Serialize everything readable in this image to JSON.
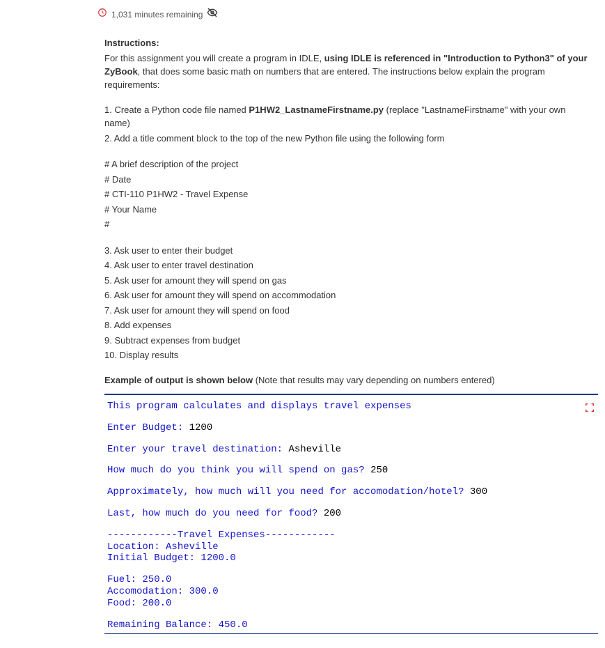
{
  "header": {
    "minutes_remaining": "1,031 minutes remaining"
  },
  "instructions": {
    "label": "Instructions:",
    "intro_pre": "For this assignment you will create a program in IDLE, ",
    "intro_bold": "using IDLE is referenced in \"Introduction to Python3\" of your ZyBook",
    "intro_post": ", that does some basic math on numbers that are entered. The instructions below explain the program requirements:",
    "step1_pre": "1. Create a Python code file named ",
    "step1_bold": "P1HW2_LastnameFirstname.py",
    "step1_post": " (replace \"LastnameFirstname\" with your own name)",
    "step2": "2. Add a title comment block to the top of the new Python file using the following form",
    "comment_lines": [
      "# A brief description of the project",
      "# Date",
      "# CTI-110 P1HW2 - Travel Expense",
      "# Your Name",
      "#"
    ],
    "steps_rest": [
      "3. Ask user to enter their budget",
      "4. Ask user to enter travel destination",
      "5. Ask user for amount they will spend on gas",
      "6. Ask user for amount they will spend on accommodation",
      "7. Ask user for amount they will spend on food",
      "8. Add expenses",
      "9. Subtract expenses from budget",
      "10. Display results"
    ],
    "example_bold": "Example of output is shown below",
    "example_rest": " (Note that results may vary depending on numbers entered)"
  },
  "code": {
    "l1": "This program calculates and displays travel expenses",
    "l2p": "Enter Budget: ",
    "l2v": "1200",
    "l3p": "Enter your travel destination: ",
    "l3v": "Asheville",
    "l4p": "How much do you think you will spend on gas? ",
    "l4v": "250",
    "l5p": "Approximately, how much will you need for accomodation/hotel? ",
    "l5v": "300",
    "l6p": "Last, how much do you need for food? ",
    "l6v": "200",
    "l7": "------------Travel Expenses------------",
    "l8": "Location: Asheville",
    "l9": "Initial Budget: 1200.0",
    "l10": "Fuel: 250.0",
    "l11": "Accomodation: 300.0",
    "l12": "Food: 200.0",
    "l13": "Remaining Balance: 450.0"
  }
}
